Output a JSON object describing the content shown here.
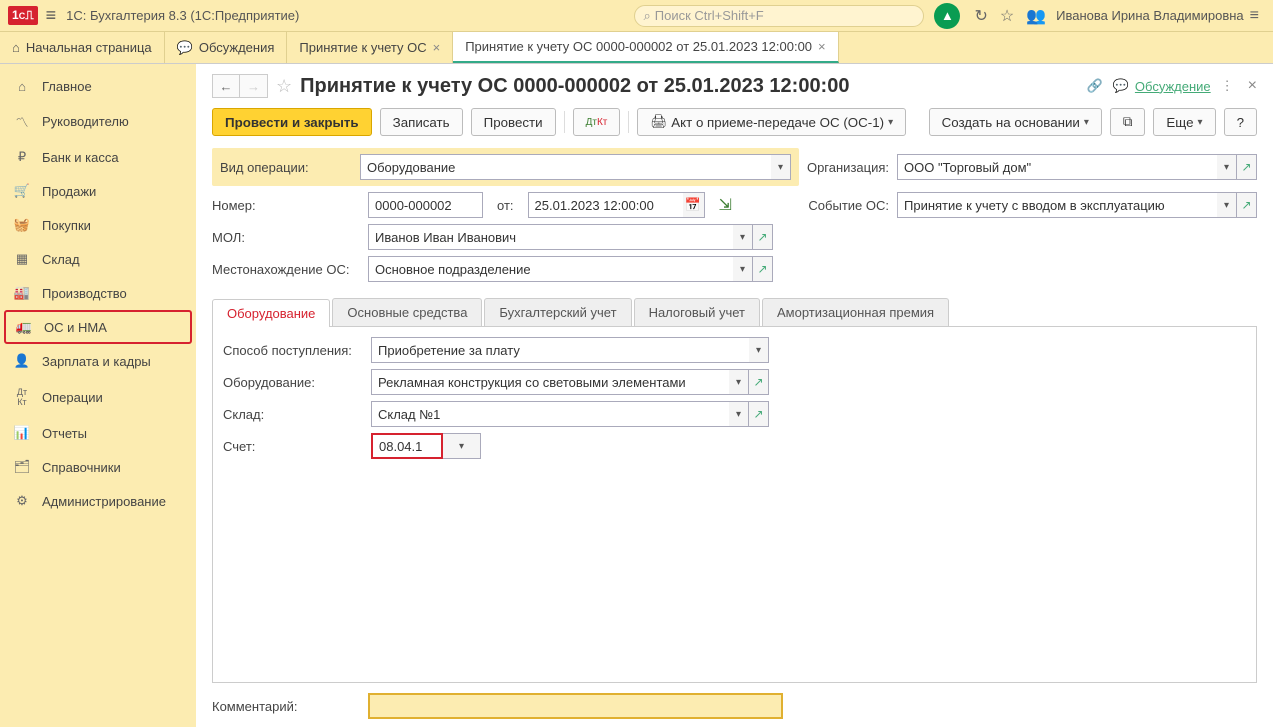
{
  "app": {
    "title": "1С: Бухгалтерия 8.3  (1С:Предприятие)",
    "user": "Иванова Ирина Владимировна"
  },
  "search": {
    "placeholder": "Поиск Ctrl+Shift+F"
  },
  "tabs": {
    "start": "Начальная страница",
    "discussions": "Обсуждения",
    "t2": "Принятие к учету ОС",
    "t3": "Принятие к учету ОС 0000-000002 от 25.01.2023 12:00:00"
  },
  "sidebar": {
    "items": [
      "Главное",
      "Руководителю",
      "Банк и касса",
      "Продажи",
      "Покупки",
      "Склад",
      "Производство",
      "ОС и НМА",
      "Зарплата и кадры",
      "Операции",
      "Отчеты",
      "Справочники",
      "Администрирование"
    ]
  },
  "page": {
    "title": "Принятие к учету ОС 0000-000002 от 25.01.2023 12:00:00",
    "discuss_label": "Обсуждение"
  },
  "toolbar": {
    "post_close": "Провести и закрыть",
    "save": "Записать",
    "post": "Провести",
    "print": "Акт о приеме-передаче ОС (ОС-1)",
    "create_base": "Создать на основании",
    "more": "Еще"
  },
  "form": {
    "op_kind_label": "Вид операции:",
    "op_kind": "Оборудование",
    "org_label": "Организация:",
    "org": "ООО \"Торговый дом\"",
    "number_label": "Номер:",
    "number": "0000-000002",
    "from_label": "от:",
    "date": "25.01.2023 12:00:00",
    "event_label": "Событие ОС:",
    "event": "Принятие к учету с вводом в эксплуатацию",
    "mol_label": "МОЛ:",
    "mol": "Иванов Иван Иванович",
    "loc_label": "Местонахождение ОС:",
    "loc": "Основное подразделение"
  },
  "inner_tabs": [
    "Оборудование",
    "Основные средства",
    "Бухгалтерский учет",
    "Налоговый учет",
    "Амортизационная премия"
  ],
  "tab1": {
    "receipt_label": "Способ поступления:",
    "receipt": "Приобретение за плату",
    "equip_label": "Оборудование:",
    "equip": "Рекламная конструкция со световыми элементами",
    "warehouse_label": "Склад:",
    "warehouse": "Склад №1",
    "account_label": "Счет:",
    "account": "08.04.1"
  },
  "comment_label": "Комментарий:"
}
